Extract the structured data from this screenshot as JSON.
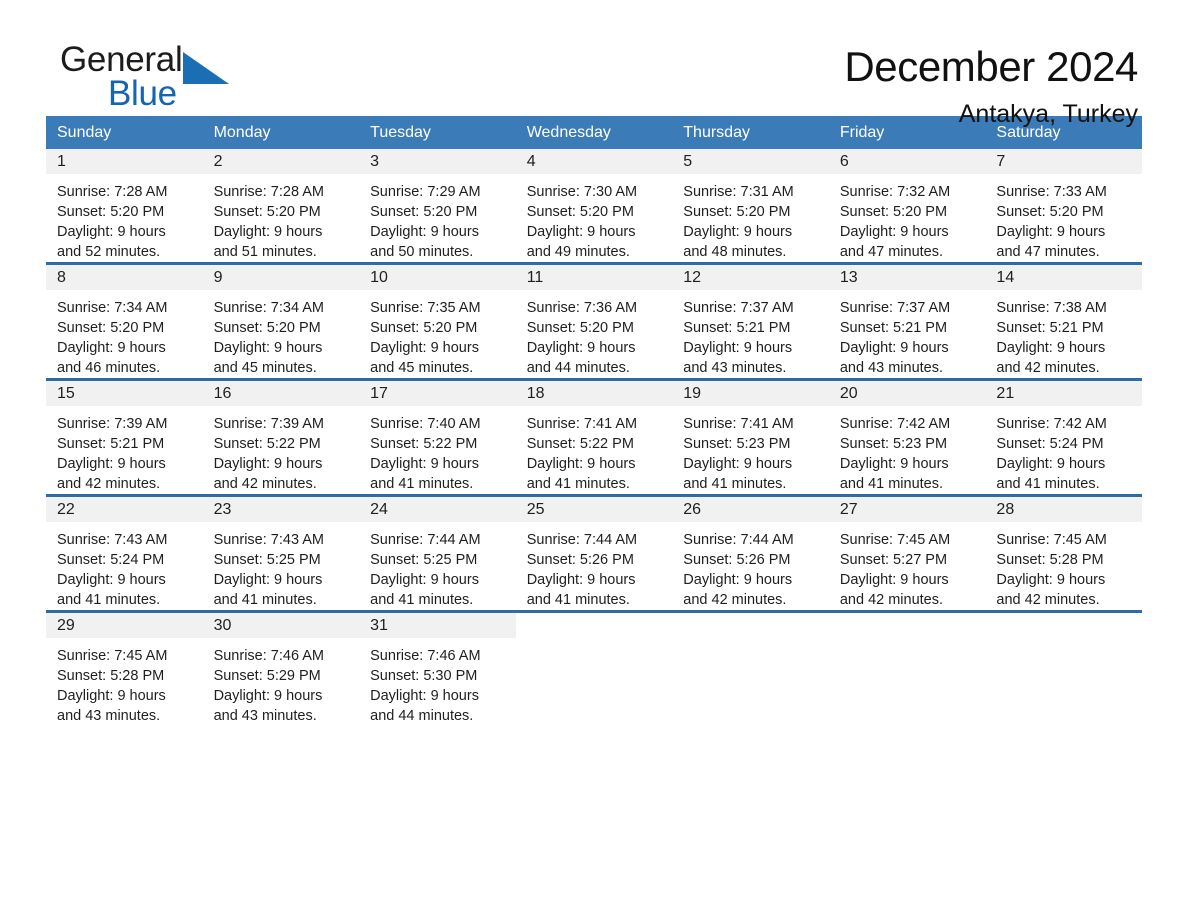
{
  "brand": {
    "line1": "General",
    "line2": "Blue",
    "triangle_icon": "triangle-logo-icon",
    "accent_color": "#1a6fb4"
  },
  "header": {
    "title": "December 2024",
    "subtitle": "Antakya, Turkey"
  },
  "theme": {
    "header_blue": "#3b7cb8",
    "rule_blue": "#2f6ca6",
    "daynum_band": "#f1f1f1"
  },
  "weekdays": [
    "Sunday",
    "Monday",
    "Tuesday",
    "Wednesday",
    "Thursday",
    "Friday",
    "Saturday"
  ],
  "weeks": [
    [
      {
        "day": "1",
        "sunrise": "Sunrise: 7:28 AM",
        "sunset": "Sunset: 5:20 PM",
        "daylight1": "Daylight: 9 hours",
        "daylight2": "and 52 minutes."
      },
      {
        "day": "2",
        "sunrise": "Sunrise: 7:28 AM",
        "sunset": "Sunset: 5:20 PM",
        "daylight1": "Daylight: 9 hours",
        "daylight2": "and 51 minutes."
      },
      {
        "day": "3",
        "sunrise": "Sunrise: 7:29 AM",
        "sunset": "Sunset: 5:20 PM",
        "daylight1": "Daylight: 9 hours",
        "daylight2": "and 50 minutes."
      },
      {
        "day": "4",
        "sunrise": "Sunrise: 7:30 AM",
        "sunset": "Sunset: 5:20 PM",
        "daylight1": "Daylight: 9 hours",
        "daylight2": "and 49 minutes."
      },
      {
        "day": "5",
        "sunrise": "Sunrise: 7:31 AM",
        "sunset": "Sunset: 5:20 PM",
        "daylight1": "Daylight: 9 hours",
        "daylight2": "and 48 minutes."
      },
      {
        "day": "6",
        "sunrise": "Sunrise: 7:32 AM",
        "sunset": "Sunset: 5:20 PM",
        "daylight1": "Daylight: 9 hours",
        "daylight2": "and 47 minutes."
      },
      {
        "day": "7",
        "sunrise": "Sunrise: 7:33 AM",
        "sunset": "Sunset: 5:20 PM",
        "daylight1": "Daylight: 9 hours",
        "daylight2": "and 47 minutes."
      }
    ],
    [
      {
        "day": "8",
        "sunrise": "Sunrise: 7:34 AM",
        "sunset": "Sunset: 5:20 PM",
        "daylight1": "Daylight: 9 hours",
        "daylight2": "and 46 minutes."
      },
      {
        "day": "9",
        "sunrise": "Sunrise: 7:34 AM",
        "sunset": "Sunset: 5:20 PM",
        "daylight1": "Daylight: 9 hours",
        "daylight2": "and 45 minutes."
      },
      {
        "day": "10",
        "sunrise": "Sunrise: 7:35 AM",
        "sunset": "Sunset: 5:20 PM",
        "daylight1": "Daylight: 9 hours",
        "daylight2": "and 45 minutes."
      },
      {
        "day": "11",
        "sunrise": "Sunrise: 7:36 AM",
        "sunset": "Sunset: 5:20 PM",
        "daylight1": "Daylight: 9 hours",
        "daylight2": "and 44 minutes."
      },
      {
        "day": "12",
        "sunrise": "Sunrise: 7:37 AM",
        "sunset": "Sunset: 5:21 PM",
        "daylight1": "Daylight: 9 hours",
        "daylight2": "and 43 minutes."
      },
      {
        "day": "13",
        "sunrise": "Sunrise: 7:37 AM",
        "sunset": "Sunset: 5:21 PM",
        "daylight1": "Daylight: 9 hours",
        "daylight2": "and 43 minutes."
      },
      {
        "day": "14",
        "sunrise": "Sunrise: 7:38 AM",
        "sunset": "Sunset: 5:21 PM",
        "daylight1": "Daylight: 9 hours",
        "daylight2": "and 42 minutes."
      }
    ],
    [
      {
        "day": "15",
        "sunrise": "Sunrise: 7:39 AM",
        "sunset": "Sunset: 5:21 PM",
        "daylight1": "Daylight: 9 hours",
        "daylight2": "and 42 minutes."
      },
      {
        "day": "16",
        "sunrise": "Sunrise: 7:39 AM",
        "sunset": "Sunset: 5:22 PM",
        "daylight1": "Daylight: 9 hours",
        "daylight2": "and 42 minutes."
      },
      {
        "day": "17",
        "sunrise": "Sunrise: 7:40 AM",
        "sunset": "Sunset: 5:22 PM",
        "daylight1": "Daylight: 9 hours",
        "daylight2": "and 41 minutes."
      },
      {
        "day": "18",
        "sunrise": "Sunrise: 7:41 AM",
        "sunset": "Sunset: 5:22 PM",
        "daylight1": "Daylight: 9 hours",
        "daylight2": "and 41 minutes."
      },
      {
        "day": "19",
        "sunrise": "Sunrise: 7:41 AM",
        "sunset": "Sunset: 5:23 PM",
        "daylight1": "Daylight: 9 hours",
        "daylight2": "and 41 minutes."
      },
      {
        "day": "20",
        "sunrise": "Sunrise: 7:42 AM",
        "sunset": "Sunset: 5:23 PM",
        "daylight1": "Daylight: 9 hours",
        "daylight2": "and 41 minutes."
      },
      {
        "day": "21",
        "sunrise": "Sunrise: 7:42 AM",
        "sunset": "Sunset: 5:24 PM",
        "daylight1": "Daylight: 9 hours",
        "daylight2": "and 41 minutes."
      }
    ],
    [
      {
        "day": "22",
        "sunrise": "Sunrise: 7:43 AM",
        "sunset": "Sunset: 5:24 PM",
        "daylight1": "Daylight: 9 hours",
        "daylight2": "and 41 minutes."
      },
      {
        "day": "23",
        "sunrise": "Sunrise: 7:43 AM",
        "sunset": "Sunset: 5:25 PM",
        "daylight1": "Daylight: 9 hours",
        "daylight2": "and 41 minutes."
      },
      {
        "day": "24",
        "sunrise": "Sunrise: 7:44 AM",
        "sunset": "Sunset: 5:25 PM",
        "daylight1": "Daylight: 9 hours",
        "daylight2": "and 41 minutes."
      },
      {
        "day": "25",
        "sunrise": "Sunrise: 7:44 AM",
        "sunset": "Sunset: 5:26 PM",
        "daylight1": "Daylight: 9 hours",
        "daylight2": "and 41 minutes."
      },
      {
        "day": "26",
        "sunrise": "Sunrise: 7:44 AM",
        "sunset": "Sunset: 5:26 PM",
        "daylight1": "Daylight: 9 hours",
        "daylight2": "and 42 minutes."
      },
      {
        "day": "27",
        "sunrise": "Sunrise: 7:45 AM",
        "sunset": "Sunset: 5:27 PM",
        "daylight1": "Daylight: 9 hours",
        "daylight2": "and 42 minutes."
      },
      {
        "day": "28",
        "sunrise": "Sunrise: 7:45 AM",
        "sunset": "Sunset: 5:28 PM",
        "daylight1": "Daylight: 9 hours",
        "daylight2": "and 42 minutes."
      }
    ],
    [
      {
        "day": "29",
        "sunrise": "Sunrise: 7:45 AM",
        "sunset": "Sunset: 5:28 PM",
        "daylight1": "Daylight: 9 hours",
        "daylight2": "and 43 minutes."
      },
      {
        "day": "30",
        "sunrise": "Sunrise: 7:46 AM",
        "sunset": "Sunset: 5:29 PM",
        "daylight1": "Daylight: 9 hours",
        "daylight2": "and 43 minutes."
      },
      {
        "day": "31",
        "sunrise": "Sunrise: 7:46 AM",
        "sunset": "Sunset: 5:30 PM",
        "daylight1": "Daylight: 9 hours",
        "daylight2": "and 44 minutes."
      },
      {
        "day": "",
        "sunrise": "",
        "sunset": "",
        "daylight1": "",
        "daylight2": ""
      },
      {
        "day": "",
        "sunrise": "",
        "sunset": "",
        "daylight1": "",
        "daylight2": ""
      },
      {
        "day": "",
        "sunrise": "",
        "sunset": "",
        "daylight1": "",
        "daylight2": ""
      },
      {
        "day": "",
        "sunrise": "",
        "sunset": "",
        "daylight1": "",
        "daylight2": ""
      }
    ]
  ]
}
